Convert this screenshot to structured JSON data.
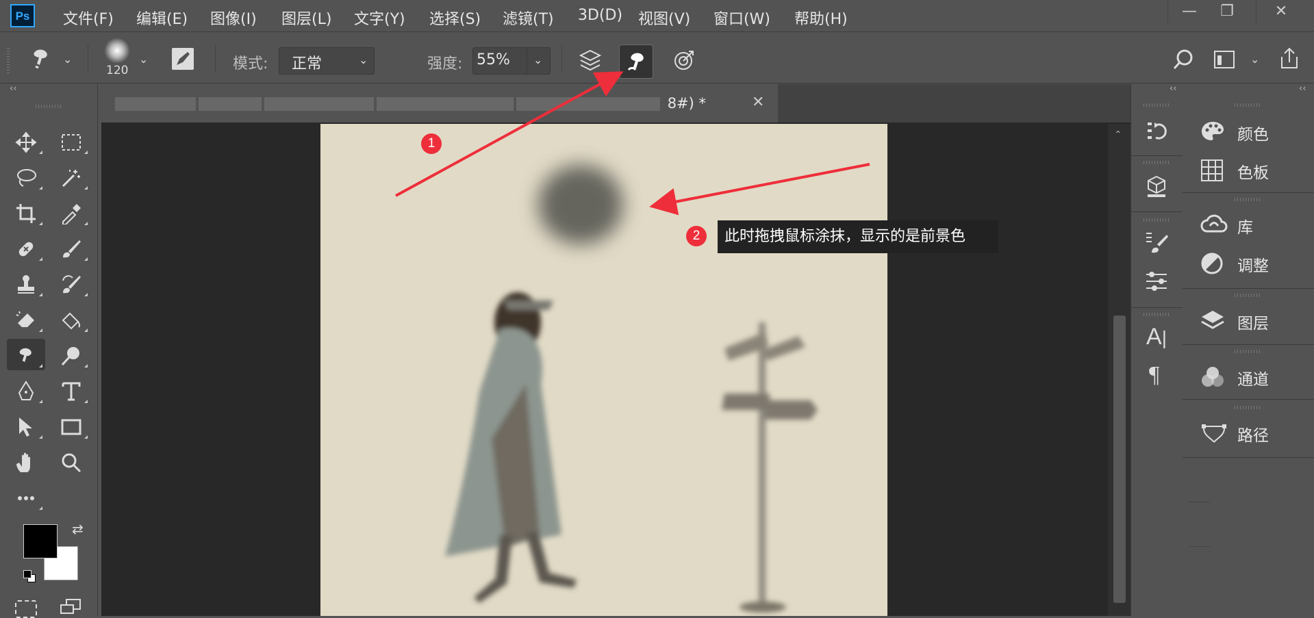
{
  "app": {
    "logo": "Ps"
  },
  "menu": [
    "文件(F)",
    "编辑(E)",
    "图像(I)",
    "图层(L)",
    "文字(Y)",
    "选择(S)",
    "滤镜(T)",
    "3D(D)",
    "视图(V)",
    "窗口(W)",
    "帮助(H)"
  ],
  "window_controls": {
    "minimize": "—",
    "restore": "❐",
    "close": "✕"
  },
  "options": {
    "brush_size": "120",
    "mode_label": "模式:",
    "mode_value": "正常",
    "strength_label": "强度:",
    "strength_value": "55%"
  },
  "document": {
    "tab_title_tail": "8#) *",
    "close_glyph": "✕"
  },
  "annotations": {
    "badge1": "1",
    "badge2": "2",
    "tooltip": "此时拖拽鼠标涂抹，显示的是前景色",
    "arrow_color": "#ee2e3a"
  },
  "panels": {
    "color": "颜色",
    "swatches": "色板",
    "libraries": "库",
    "adjustments": "调整",
    "layers": "图层",
    "channels": "通道",
    "paths": "路径"
  },
  "colors": {
    "foreground": "#000000",
    "background": "#ffffff",
    "canvas": "#e1dac6"
  }
}
